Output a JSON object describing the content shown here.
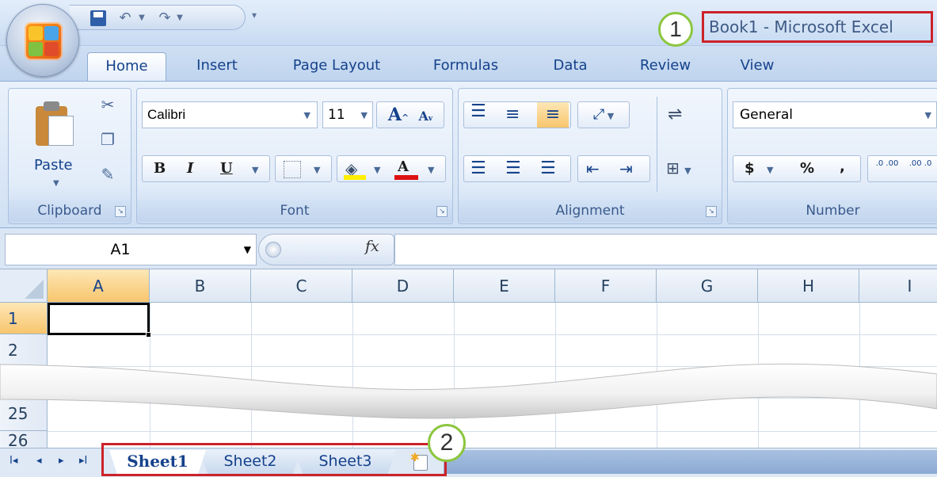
{
  "title_bar": {
    "app_title": "Book1 - Microsoft Excel",
    "callout_number": "1",
    "qat_separator": "▾"
  },
  "ribbon_tabs": [
    "Home",
    "Insert",
    "Page Layout",
    "Formulas",
    "Data",
    "Review",
    "View"
  ],
  "active_tab": "Home",
  "ribbon": {
    "clipboard": {
      "paste_label": "Paste",
      "group_label": "Clipboard"
    },
    "font": {
      "font_name": "Calibri",
      "font_size": "11",
      "bold": "B",
      "italic": "I",
      "underline": "U",
      "grow": "A",
      "shrink": "A",
      "font_color_letter": "A",
      "group_label": "Font"
    },
    "alignment": {
      "group_label": "Alignment"
    },
    "number": {
      "format": "General",
      "currency": "$",
      "percent": "%",
      "comma": ",",
      "increase_decimal": ".0 .00",
      "decrease_decimal": ".00 .0",
      "group_label": "Number"
    }
  },
  "formula_bar": {
    "name_box": "A1",
    "fx_label": "fx",
    "formula": ""
  },
  "grid": {
    "columns": [
      "A",
      "B",
      "C",
      "D",
      "E",
      "F",
      "G",
      "H",
      "I"
    ],
    "rows": [
      "1",
      "2",
      "25",
      "26"
    ],
    "selected_column": "A",
    "selected_row": "1"
  },
  "sheets": {
    "tabs": [
      "Sheet1",
      "Sheet2",
      "Sheet3"
    ],
    "active": "Sheet1",
    "nav": [
      "I◂",
      "◂",
      "▸",
      "▸I"
    ],
    "callout_number": "2"
  },
  "colors": {
    "highlight_box": "#cc2229",
    "callout_ring": "#8cc63f",
    "selection_header": "#f7c56d",
    "fill_yellow": "#ffee00",
    "font_red": "#dd1111"
  }
}
